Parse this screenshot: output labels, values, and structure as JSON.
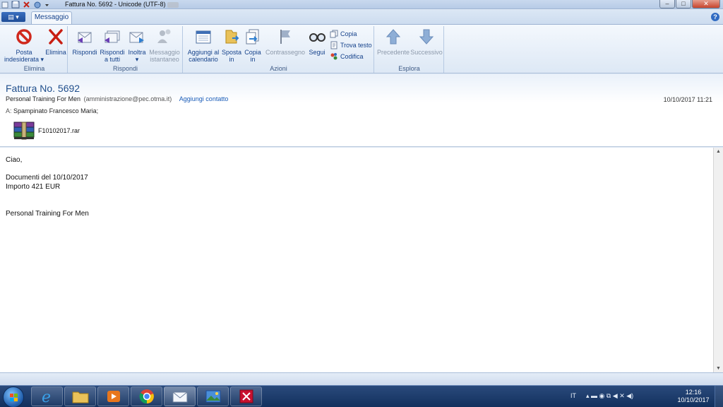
{
  "window": {
    "title": "Fattura No. 5692 - Unicode (UTF-8)",
    "minimize_glyph": "–",
    "maximize_glyph": "□",
    "close_glyph": "✕"
  },
  "tabs": {
    "file_glyph": "▤ ▾",
    "active": "Messaggio",
    "help_glyph": "?"
  },
  "ribbon": {
    "groups": {
      "elimina": "Elimina",
      "rispondi": "Rispondi",
      "azioni": "Azioni",
      "esplora": "Esplora"
    },
    "buttons": {
      "posta_indesiderata_1": "Posta",
      "posta_indesiderata_2": "indesiderata ▾",
      "elimina": "Elimina",
      "rispondi": "Rispondi",
      "rispondi_tutti_1": "Rispondi",
      "rispondi_tutti_2": "a tutti",
      "inoltra_1": "Inoltra",
      "inoltra_2": "▾",
      "messaggio_istantaneo_1": "Messaggio",
      "messaggio_istantaneo_2": "istantaneo",
      "aggiungi_calendario_1": "Aggiungi al",
      "aggiungi_calendario_2": "calendario",
      "sposta_1": "Sposta",
      "sposta_2": "in",
      "copia_in_1": "Copia",
      "copia_in_2": "in",
      "contrassegno": "Contrassegno",
      "segui": "Segui",
      "copia": "Copia",
      "trova_testo": "Trova testo",
      "codifica": "Codifica",
      "precedente": "Precedente",
      "successivo": "Successivo"
    }
  },
  "message": {
    "subject": "Fattura No. 5692",
    "sender_name": "Personal Training For Men",
    "sender_email": "(amministrazione@pec.otma.it)",
    "add_contact": "Aggiungi contatto",
    "date": "10/10/2017 11:21",
    "to_label": "A:",
    "to_value": "Spampinato Francesco Maria;",
    "attachment": "F10102017.rar",
    "body": {
      "greeting": "Ciao,",
      "line1": "Documenti del 10/10/2017",
      "line2": "Importo 421 EUR",
      "signature": "Personal Training For Men"
    }
  },
  "taskbar": {
    "language": "IT",
    "time": "12:16",
    "date": "10/10/2017",
    "tray_glyphs": "▴ ▬ ◉ ⧉ ◀ ✕ ◀)"
  },
  "colors": {
    "accent": "#1f4e8c",
    "link": "#1a5cb8",
    "taskbar": "#12305e"
  }
}
